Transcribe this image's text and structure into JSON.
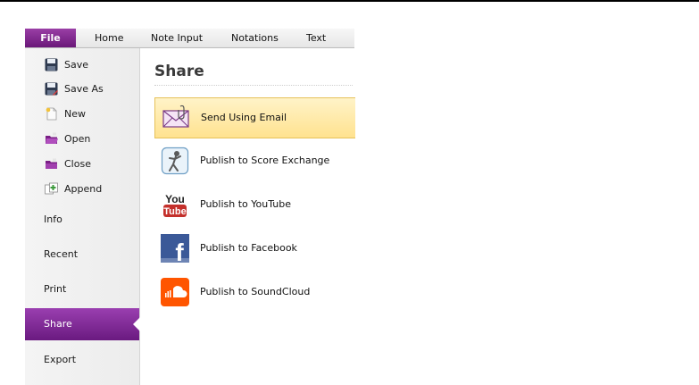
{
  "ribbon": {
    "tabs": [
      {
        "label": "File",
        "active": true
      },
      {
        "label": "Home"
      },
      {
        "label": "Note Input"
      },
      {
        "label": "Notations"
      },
      {
        "label": "Text"
      }
    ]
  },
  "sidebar": {
    "commands": [
      {
        "label": "Save",
        "icon": "save-icon"
      },
      {
        "label": "Save As",
        "icon": "save-as-icon"
      },
      {
        "label": "New",
        "icon": "new-document-icon"
      },
      {
        "label": "Open",
        "icon": "open-folder-icon"
      },
      {
        "label": "Close",
        "icon": "close-folder-icon"
      },
      {
        "label": "Append",
        "icon": "append-icon"
      }
    ],
    "sections": [
      {
        "label": "Info"
      },
      {
        "label": "Recent"
      },
      {
        "label": "Print"
      },
      {
        "label": "Share",
        "active": true
      },
      {
        "label": "Export"
      }
    ]
  },
  "main": {
    "title": "Share",
    "items": [
      {
        "label": "Send Using Email",
        "icon": "email-envelope-icon",
        "selected": true
      },
      {
        "label": "Publish to Score Exchange",
        "icon": "score-exchange-icon"
      },
      {
        "label": "Publish to YouTube",
        "icon": "youtube-icon",
        "icon_text": [
          "You",
          "Tube"
        ]
      },
      {
        "label": "Publish to Facebook",
        "icon": "facebook-icon",
        "icon_text": "f"
      },
      {
        "label": "Publish to SoundCloud",
        "icon": "soundcloud-icon"
      }
    ]
  },
  "colors": {
    "accent_purple": "#7a2289",
    "selected_item": "#ffe69a",
    "facebook_blue": "#3b5998",
    "youtube_red": "#c4302b",
    "soundcloud_orange": "#ff5500"
  }
}
